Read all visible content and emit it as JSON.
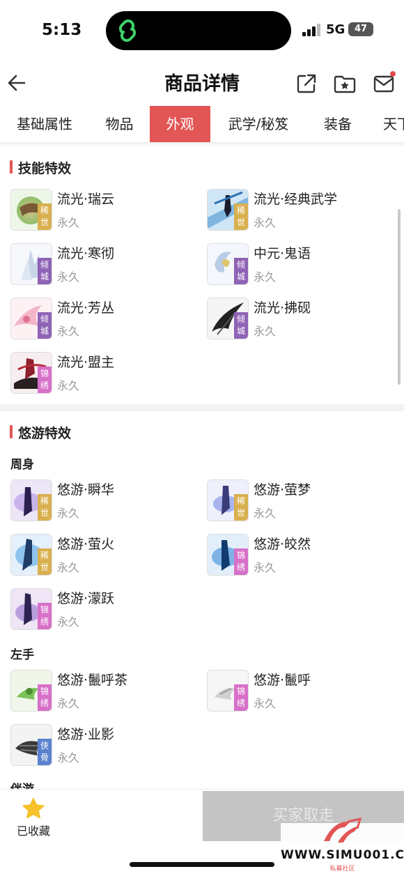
{
  "status_bar": {
    "time": "5:13",
    "network": "5G",
    "battery": "47"
  },
  "header": {
    "title": "商品详情"
  },
  "tabs": [
    {
      "label": "基础属性",
      "active": false
    },
    {
      "label": "物品",
      "active": false
    },
    {
      "label": "外观",
      "active": true
    },
    {
      "label": "武学/秘笈",
      "active": false
    },
    {
      "label": "装备",
      "active": false
    },
    {
      "label": "天下",
      "active": false
    }
  ],
  "skill_effects": {
    "title": "技能特效",
    "items": [
      {
        "name": "流光·瑞云",
        "duration": "永久",
        "tag": "稀世"
      },
      {
        "name": "流光·经典武学",
        "duration": "永久",
        "tag": "稀世"
      },
      {
        "name": "流光·寒彻",
        "duration": "永久",
        "tag": "倾城"
      },
      {
        "name": "中元·鬼语",
        "duration": "永久",
        "tag": "倾城"
      },
      {
        "name": "流光·芳丛",
        "duration": "永久",
        "tag": "倾城"
      },
      {
        "name": "流光·拂砚",
        "duration": "永久",
        "tag": "倾城"
      },
      {
        "name": "流光·盟主",
        "duration": "永久",
        "tag": "锦绣"
      }
    ]
  },
  "roam_effects": {
    "title": "悠游特效",
    "groups": [
      {
        "label": "周身",
        "items": [
          {
            "name": "悠游·瞬华",
            "duration": "永久",
            "tag": "稀世"
          },
          {
            "name": "悠游·萤梦",
            "duration": "永久",
            "tag": "稀世"
          },
          {
            "name": "悠游·萤火",
            "duration": "永久",
            "tag": "稀世"
          },
          {
            "name": "悠游·皎然",
            "duration": "永久",
            "tag": "锦绣"
          },
          {
            "name": "悠游·濛跃",
            "duration": "永久",
            "tag": "锦绣"
          }
        ]
      },
      {
        "label": "左手",
        "items": [
          {
            "name": "悠游·鬛呼茶",
            "duration": "永久",
            "tag": "锦绣"
          },
          {
            "name": "悠游·鬛呼",
            "duration": "永久",
            "tag": "锦绣"
          },
          {
            "name": "悠游·业影",
            "duration": "永久",
            "tag": "侠骨"
          }
        ]
      },
      {
        "label": "伴游",
        "items": []
      }
    ]
  },
  "bottom_bar": {
    "favorite_label": "已收藏",
    "buy_label": "买家取走"
  },
  "watermark": {
    "url": "WWW.SIMU001.CN",
    "cn": "私募社区"
  },
  "colors": {
    "accent": "#e25656",
    "xishi": "#d9b04f",
    "qingcheng": "#8e62b5",
    "jinxiu": "#d770c8",
    "xiagu": "#5b82cf"
  }
}
